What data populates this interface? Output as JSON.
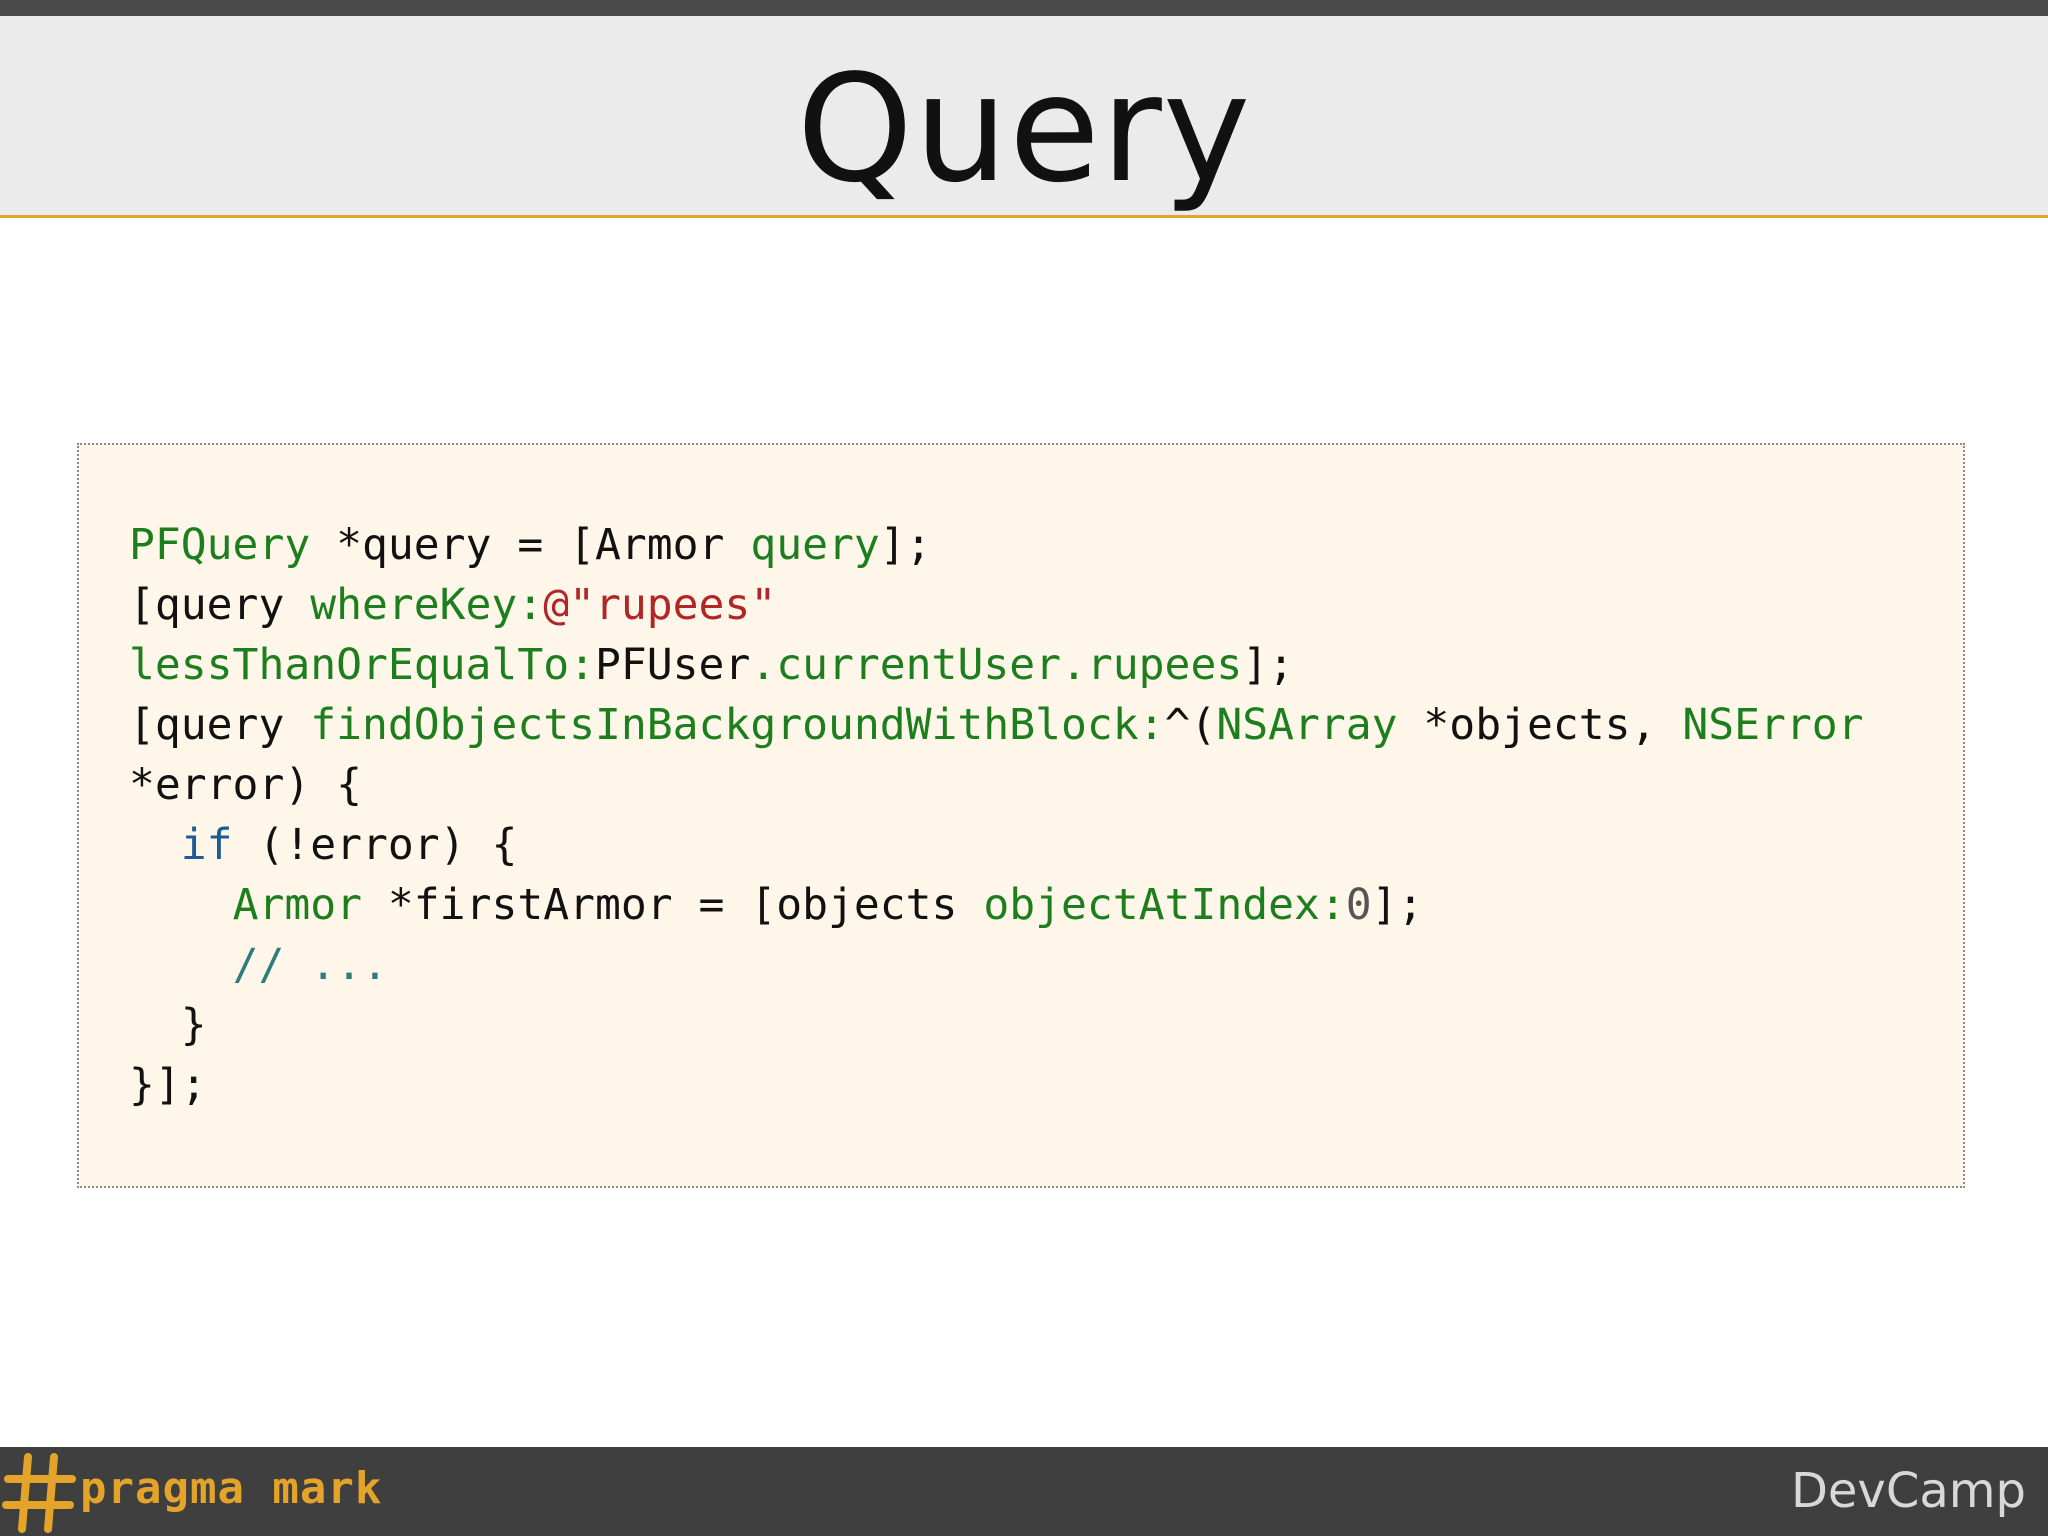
{
  "slide": {
    "title": "Query"
  },
  "code": {
    "line1": {
      "t1": "PFQuery",
      "t2": " *query = [Armor ",
      "t3": "query",
      "t4": "];"
    },
    "line2": {
      "t1": "[query ",
      "t2": "whereKey:",
      "t3": "@\"rupees\""
    },
    "line3": {
      "t1": "lessThanOrEqualTo:",
      "t2": "PFUser",
      "t3": ".currentUser.rupees",
      "t4": "];"
    },
    "line4": {
      "t1": "[query ",
      "t2": "findObjectsInBackgroundWithBlock:",
      "t3": "^(",
      "t4": "NSArray",
      "t5": " *objects, ",
      "t6": "NSError"
    },
    "line5": {
      "t1": "*error) {"
    },
    "line6": {
      "t1": "  ",
      "t2": "if",
      "t3": " (!error) {"
    },
    "line7": {
      "t1": "    ",
      "t2": "Armor",
      "t3": " *firstArmor = [objects ",
      "t4": "objectAtIndex:",
      "t5": "0",
      "t6": "];"
    },
    "line8": {
      "t1": "    ",
      "t2": "// ..."
    },
    "line9": {
      "t1": "  }"
    },
    "line10": {
      "t1": "}];"
    }
  },
  "footer": {
    "logo_text": "pragma mark",
    "brand": "DevCamp",
    "accent_color": "#e4a42a"
  }
}
